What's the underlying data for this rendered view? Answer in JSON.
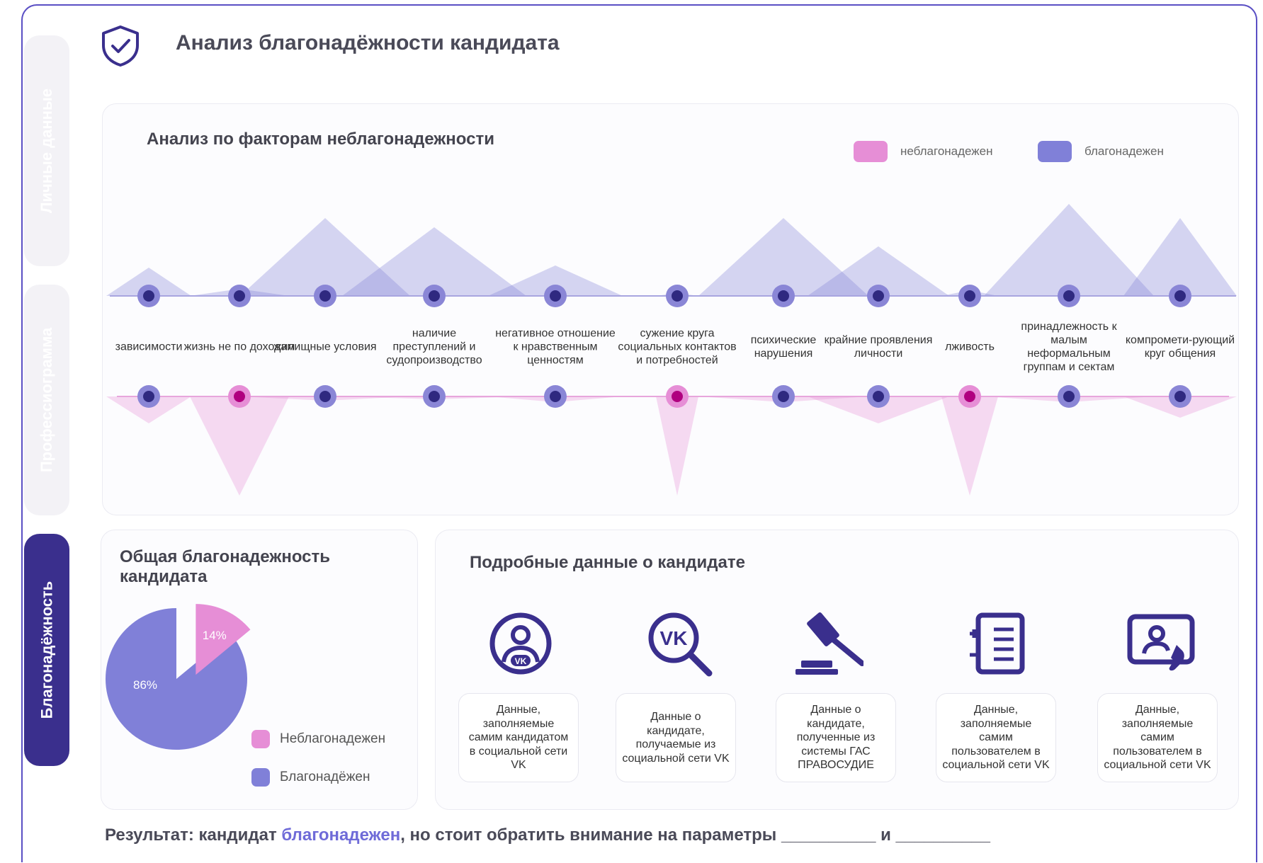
{
  "tabs": [
    {
      "label": "Личные данные",
      "active": false
    },
    {
      "label": "Профессиограмма",
      "active": false
    },
    {
      "label": "Благонадёжность",
      "active": true
    }
  ],
  "page_title": "Анализ благонадёжности кандидата",
  "factors_panel": {
    "title": "Анализ по факторам неблагонадежности",
    "legend": [
      {
        "label": "неблагонадежен",
        "color": "#e68ed6"
      },
      {
        "label": "благонадежен",
        "color": "#8080d8"
      }
    ]
  },
  "chart_data": {
    "type": "area",
    "title": "Анализ по факторам неблагонадежности",
    "categories": [
      "зависимости",
      "жизнь не по доходам",
      "жилищные условия",
      "наличие преступлений и судопроизводство",
      "негативное отношение к нравственным ценностям",
      "сужение круга социальных контактов и потребностей",
      "психические нарушения",
      "крайние проявления личности",
      "лживость",
      "принадлежность к малым неформальным группам и сектам",
      "компромети-рующий круг общения"
    ],
    "series": [
      {
        "name": "благонадежен",
        "color": "#8080d8",
        "values": [
          40,
          10,
          110,
          97,
          43,
          4,
          110,
          70,
          8,
          130,
          110
        ]
      },
      {
        "name": "неблагонадежен",
        "color": "#e68ed6",
        "values": [
          38,
          140,
          6,
          4,
          8,
          140,
          8,
          38,
          140,
          8,
          30
        ]
      }
    ],
    "marker_status": [
      "ok",
      "risk",
      "ok",
      "ok",
      "ok",
      "risk",
      "ok",
      "ok",
      "risk",
      "ok",
      "ok"
    ]
  },
  "overall_panel": {
    "title": "Общая благонадежность кандидата",
    "pie": [
      {
        "label": "Неблагонадежен",
        "value": 14,
        "text": "14%",
        "color": "#e68ed6"
      },
      {
        "label": "Благонадёжен",
        "value": 86,
        "text": "86%",
        "color": "#8080d8"
      }
    ]
  },
  "details_panel": {
    "title": "Подробные данные о кандидате",
    "sources": [
      {
        "icon": "vk-user-icon",
        "text": "Данные, заполняемые самим кандидатом в социальной сети VK"
      },
      {
        "icon": "vk-search-icon",
        "text": "Данные о кандидате, получаемые из социальной сети VK"
      },
      {
        "icon": "gavel-icon",
        "text": "Данные о кандидате, полученные из системы ГАС ПРАВОСУДИЕ"
      },
      {
        "icon": "form-list-icon",
        "text": "Данные, заполняемые самим пользователем в социальной сети VK"
      },
      {
        "icon": "contact-card-icon",
        "text": "Данные, заполняемые самим пользователем в социальной сети VK"
      }
    ]
  },
  "result": {
    "prefix": "Результат: кандидат",
    "status": "благонадежен",
    "suffix": ", но стоит обратить внимание на параметры __________ и __________"
  }
}
